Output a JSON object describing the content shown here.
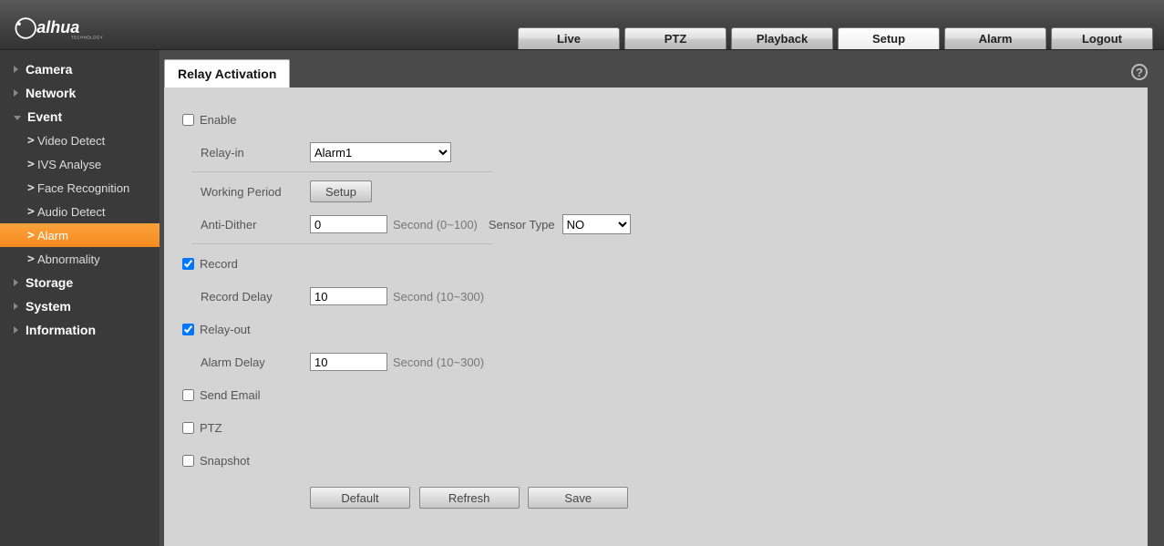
{
  "brand": {
    "name": "alhua",
    "subtitle": "TECHNOLOGY"
  },
  "topnav": {
    "live": "Live",
    "ptz": "PTZ",
    "playback": "Playback",
    "setup": "Setup",
    "alarm": "Alarm",
    "logout": "Logout"
  },
  "sidebar": {
    "camera": "Camera",
    "network": "Network",
    "event": "Event",
    "event_children": {
      "video_detect": "Video Detect",
      "ivs_analyse": "IVS Analyse",
      "face_recognition": "Face Recognition",
      "audio_detect": "Audio Detect",
      "alarm": "Alarm",
      "abnormality": "Abnormality"
    },
    "storage": "Storage",
    "system": "System",
    "information": "Information"
  },
  "tab": {
    "relay_activation": "Relay Activation"
  },
  "form": {
    "enable_label": "Enable",
    "enable_checked": false,
    "relay_in_label": "Relay-in",
    "relay_in_value": "Alarm1",
    "working_period_label": "Working Period",
    "setup_button": "Setup",
    "anti_dither_label": "Anti-Dither",
    "anti_dither_value": "0",
    "anti_dither_unit": "Second (0~100)",
    "sensor_type_label": "Sensor Type",
    "sensor_type_value": "NO",
    "record_label": "Record",
    "record_checked": true,
    "record_delay_label": "Record Delay",
    "record_delay_value": "10",
    "record_delay_unit": "Second (10~300)",
    "relay_out_label": "Relay-out",
    "relay_out_checked": true,
    "alarm_delay_label": "Alarm Delay",
    "alarm_delay_value": "10",
    "alarm_delay_unit": "Second (10~300)",
    "send_email_label": "Send Email",
    "send_email_checked": false,
    "ptz_label": "PTZ",
    "ptz_checked": false,
    "snapshot_label": "Snapshot",
    "snapshot_checked": false,
    "default_button": "Default",
    "refresh_button": "Refresh",
    "save_button": "Save"
  },
  "help_glyph": "?"
}
